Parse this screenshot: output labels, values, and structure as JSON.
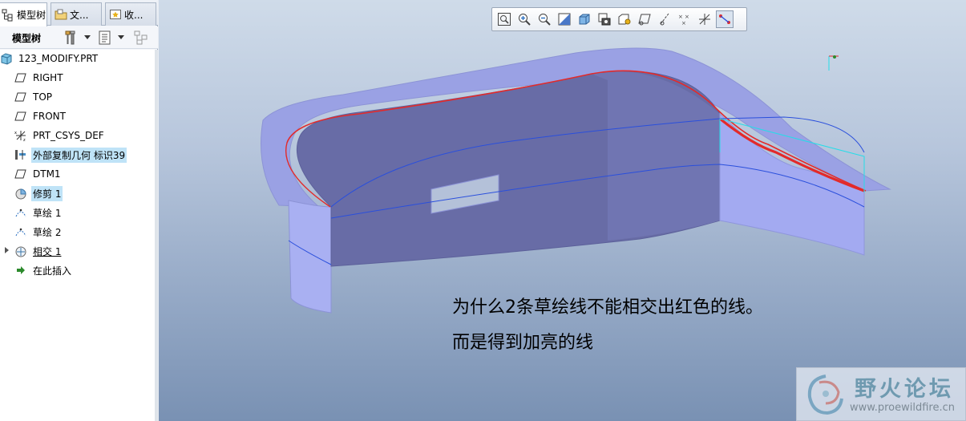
{
  "tabs": [
    {
      "label": "模型树",
      "icon": "model-tree-icon",
      "active": true
    },
    {
      "label": "文...",
      "icon": "folder-icon",
      "active": false
    },
    {
      "label": "收...",
      "icon": "favorites-icon",
      "active": false
    }
  ],
  "tree_toolbar": {
    "title": "模型树",
    "settings_icon": "tools-icon",
    "show_icon": "list-icon",
    "filter_icon": "filter-icon"
  },
  "tree": {
    "root": {
      "label": "123_MODIFY.PRT",
      "icon": "part-icon"
    },
    "items": [
      {
        "label": "RIGHT",
        "icon": "datum-plane-icon"
      },
      {
        "label": "TOP",
        "icon": "datum-plane-icon"
      },
      {
        "label": "FRONT",
        "icon": "datum-plane-icon"
      },
      {
        "label": "PRT_CSYS_DEF",
        "icon": "csys-icon"
      },
      {
        "label": "外部复制几何 标识39",
        "icon": "copy-geometry-icon"
      },
      {
        "label": "DTM1",
        "icon": "datum-plane-icon"
      },
      {
        "label": "修剪 1",
        "icon": "trim-icon"
      },
      {
        "label": "草绘 1",
        "icon": "sketch-icon"
      },
      {
        "label": "草绘 2",
        "icon": "sketch-icon"
      },
      {
        "label": "相交 1",
        "icon": "intersect-icon"
      },
      {
        "label": "在此插入",
        "icon": "insert-arrow-icon"
      }
    ]
  },
  "view_toolbar": {
    "buttons": [
      {
        "name": "zoom-fit",
        "icon": "zoom-fit-icon"
      },
      {
        "name": "zoom-in",
        "icon": "zoom-in-icon"
      },
      {
        "name": "zoom-out",
        "icon": "zoom-out-icon"
      },
      {
        "name": "repaint",
        "icon": "repaint-icon"
      },
      {
        "name": "display-style",
        "icon": "display-style-icon"
      },
      {
        "name": "saved-views",
        "icon": "saved-views-icon"
      },
      {
        "name": "view-manager",
        "icon": "view-manager-icon"
      },
      {
        "name": "datum-planes",
        "icon": "datum-plane-toggle-icon"
      },
      {
        "name": "datum-axes",
        "icon": "datum-axis-toggle-icon"
      },
      {
        "name": "datum-points",
        "icon": "datum-point-toggle-icon"
      },
      {
        "name": "csys-display",
        "icon": "csys-toggle-icon"
      },
      {
        "name": "annotations",
        "icon": "annotation-toggle-icon",
        "active": true
      }
    ]
  },
  "viewport": {
    "question_line1": "为什么2条草绘线不能相交出红色的线。",
    "question_line2": "而是得到加亮的线"
  },
  "watermark": {
    "name": "野火论坛",
    "url": "www.proewildfire.cn"
  },
  "colors": {
    "surface_light": "#a2aaf0",
    "surface_dark": "#6b6fa6",
    "sketch_line": "#2a4fdc",
    "highlight_line": "#e32a2a",
    "cyan_line": "#25dde8"
  }
}
